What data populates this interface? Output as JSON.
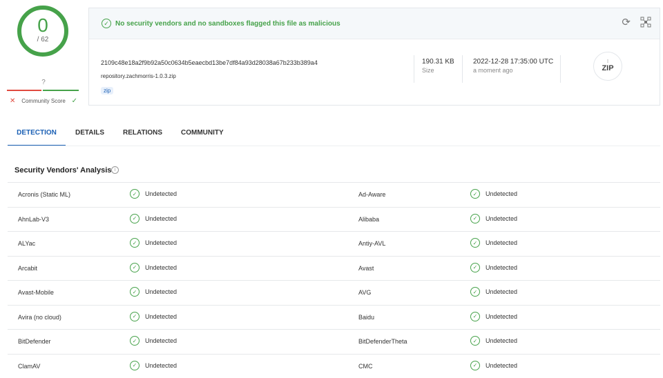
{
  "score": {
    "detections": "0",
    "total": "/ 62",
    "community_value": "?",
    "community_label": "Community Score"
  },
  "file": {
    "status_message": "No security vendors and no sandboxes flagged this file as malicious",
    "hash": "2109c48e18a2f9b92a50c0634b5eaecbd13be7df84a93d28038a67b233b389a4",
    "name": "repository.zachmorris-1.0.3.zip",
    "tag": "zip",
    "size": "190.31 KB",
    "size_label": "Size",
    "date": "2022-12-28 17:35:00 UTC",
    "date_relative": "a moment ago",
    "type_icon_label": "ZIP"
  },
  "tabs": [
    "DETECTION",
    "DETAILS",
    "RELATIONS",
    "COMMUNITY"
  ],
  "vendors": {
    "title": "Security Vendors' Analysis",
    "rows": [
      {
        "left_name": "Acronis (Static ML)",
        "left_result": "Undetected",
        "right_name": "Ad-Aware",
        "right_result": "Undetected"
      },
      {
        "left_name": "AhnLab-V3",
        "left_result": "Undetected",
        "right_name": "Alibaba",
        "right_result": "Undetected"
      },
      {
        "left_name": "ALYac",
        "left_result": "Undetected",
        "right_name": "Antiy-AVL",
        "right_result": "Undetected"
      },
      {
        "left_name": "Arcabit",
        "left_result": "Undetected",
        "right_name": "Avast",
        "right_result": "Undetected"
      },
      {
        "left_name": "Avast-Mobile",
        "left_result": "Undetected",
        "right_name": "AVG",
        "right_result": "Undetected"
      },
      {
        "left_name": "Avira (no cloud)",
        "left_result": "Undetected",
        "right_name": "Baidu",
        "right_result": "Undetected"
      },
      {
        "left_name": "BitDefender",
        "left_result": "Undetected",
        "right_name": "BitDefenderTheta",
        "right_result": "Undetected"
      },
      {
        "left_name": "ClamAV",
        "left_result": "Undetected",
        "right_name": "CMC",
        "right_result": "Undetected"
      }
    ]
  },
  "colors": {
    "clean": "#46a24a",
    "malicious": "#e04a3f",
    "accent": "#1a5fb4"
  }
}
